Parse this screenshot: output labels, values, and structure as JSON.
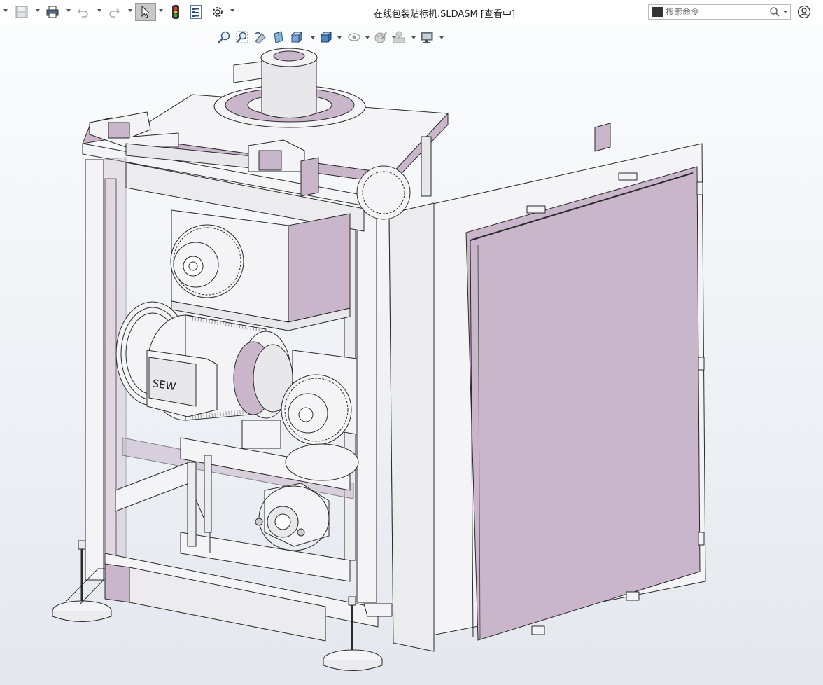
{
  "window": {
    "document_title": "在线包装贴标机.SLDASM [查看中]"
  },
  "toolbar": {
    "icons": [
      "save-icon",
      "print-icon",
      "undo-icon",
      "redo-icon",
      "select-icon",
      "rebuild-traffic-light-icon",
      "file-properties-icon",
      "options-gear-icon"
    ]
  },
  "search": {
    "placeholder": "搜索命令"
  },
  "heads_up_toolbar": {
    "icons": [
      "zoom-to-fit-icon",
      "zoom-to-area-icon",
      "previous-view-icon",
      "section-view-icon",
      "view-orientation-icon",
      "display-style-icon",
      "hide-show-items-icon",
      "edit-appearance-icon",
      "apply-scene-icon",
      "view-settings-icon"
    ]
  },
  "model": {
    "motor_brand": "SEW"
  },
  "colors": {
    "part_lilac": "#c9b6cb",
    "part_light": "#f4f3f5",
    "edge": "#2a2a2a",
    "background_top": "#fbfcfd",
    "background_bottom": "#e4e8ee"
  }
}
